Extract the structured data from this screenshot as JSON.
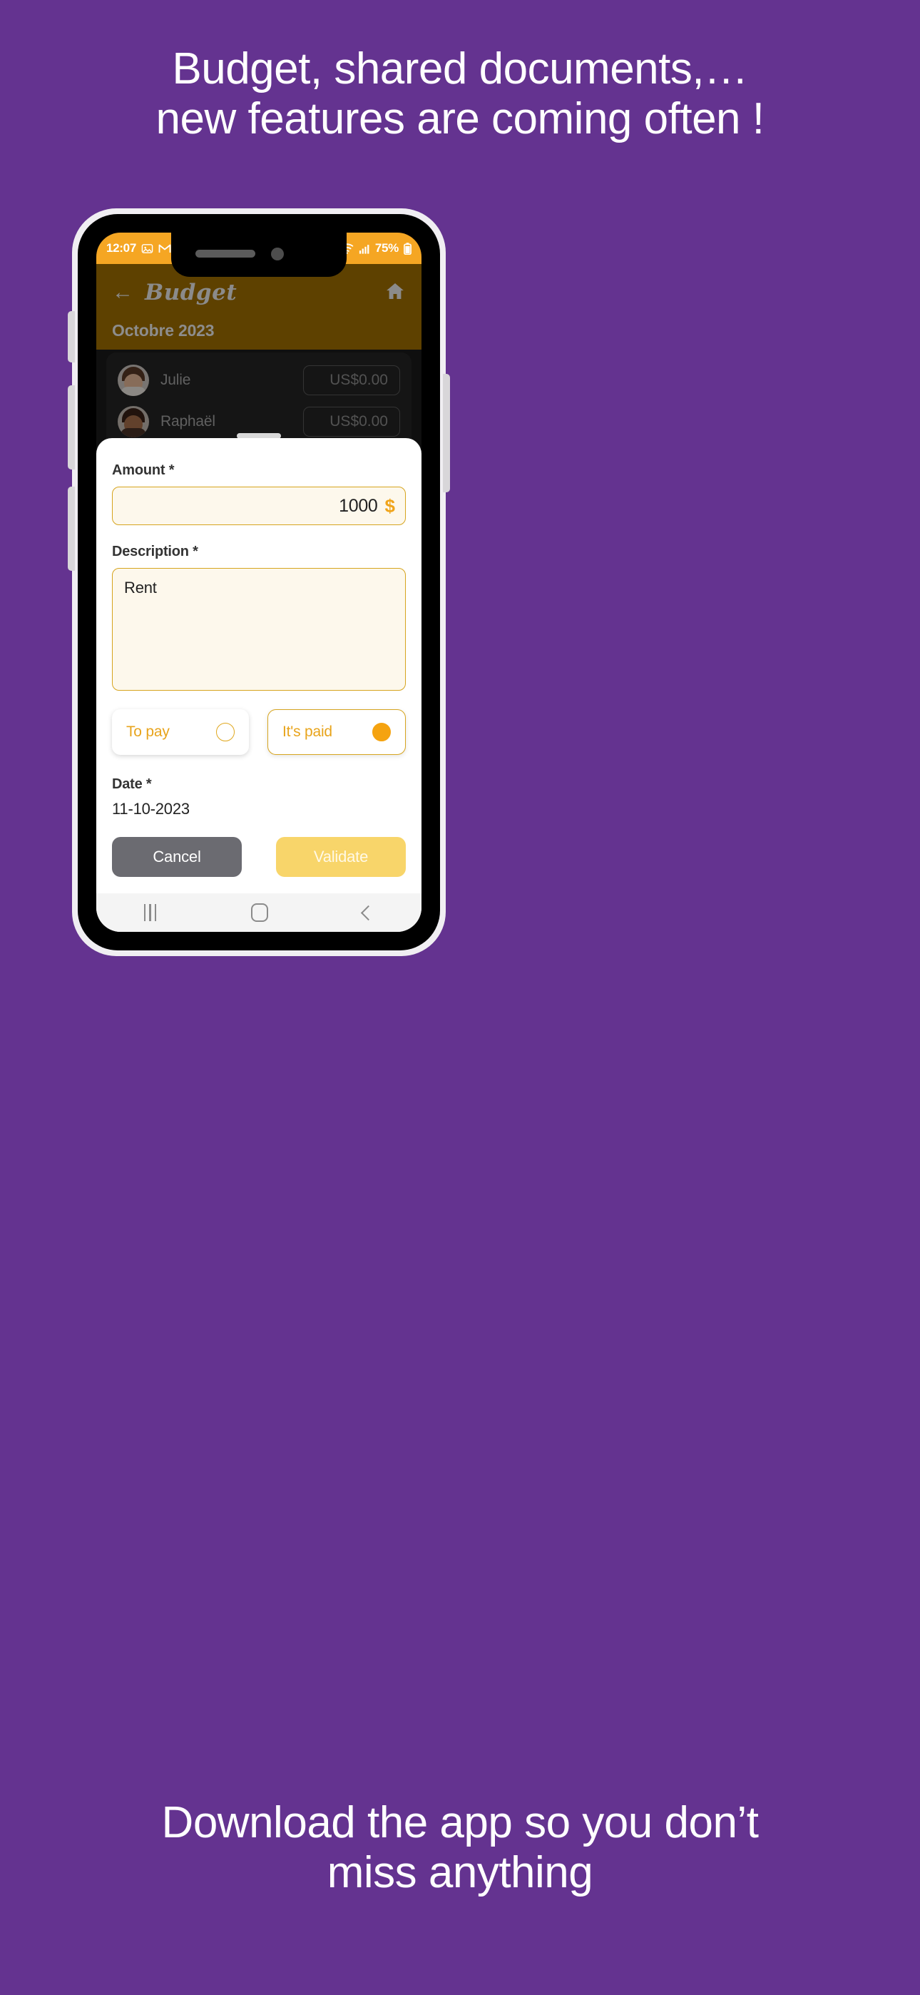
{
  "page": {
    "background_color": "#643390"
  },
  "headline_top": {
    "lines": [
      "Budget, shared documents,…",
      "new features are coming often !"
    ]
  },
  "headline_bottom": {
    "lines": [
      "Download the app so you don’t",
      "miss anything"
    ]
  },
  "phone": {
    "status_bar": {
      "time": "12:07",
      "battery_percent": "75%",
      "icons": [
        "image-icon",
        "gmail-icon",
        "wifi-icon",
        "signal-icon",
        "battery-icon"
      ],
      "background_color": "#f5a623"
    },
    "app_header": {
      "back_icon": "back-arrow-icon",
      "title": "Budget",
      "home_icon": "home-icon",
      "month": "Octobre 2023",
      "background_color": "#5e4100"
    },
    "members": [
      {
        "name": "Julie",
        "amount": "US$0.00"
      },
      {
        "name": "Raphaël",
        "amount": "US$0.00"
      }
    ],
    "sheet": {
      "amount": {
        "label": "Amount *",
        "value": "1000",
        "currency": "$"
      },
      "description": {
        "label": "Description *",
        "value": "Rent"
      },
      "status_options": [
        {
          "label": "To pay",
          "selected": false
        },
        {
          "label": "It's paid",
          "selected": true
        }
      ],
      "date": {
        "label": "Date *",
        "value": "11-10-2023"
      },
      "buttons": {
        "cancel": "Cancel",
        "validate": "Validate"
      },
      "accent_color": "#d6a41e",
      "field_background": "#fdf8ec"
    },
    "nav_bar": {
      "recents_icon": "recents-icon",
      "home_icon": "home-square-icon",
      "back_icon": "back-chevron-icon"
    }
  }
}
